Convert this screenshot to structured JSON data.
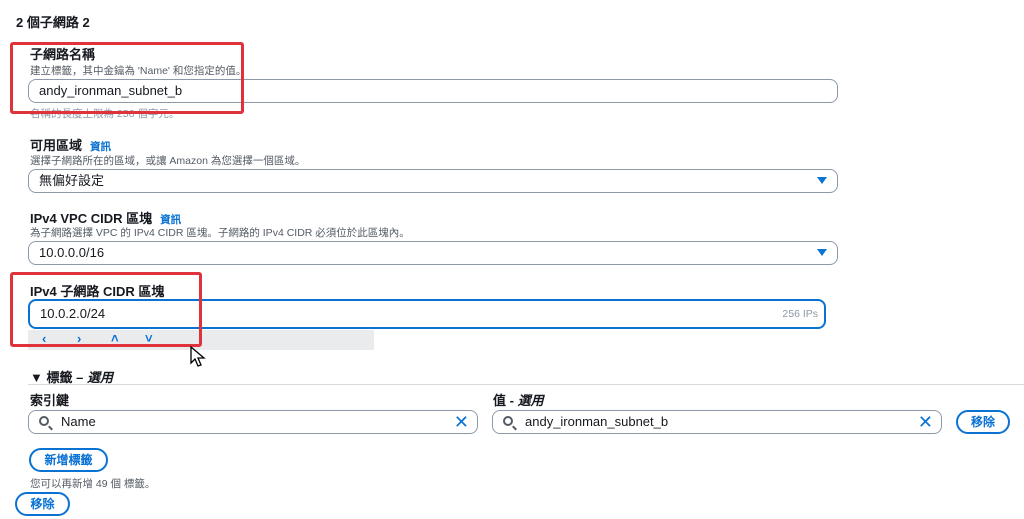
{
  "section_title": "2 個子網路 2",
  "subnet_name": {
    "label": "子網路名稱",
    "desc": "建立標籤，其中金鑰為 'Name' 和您指定的值。",
    "value": "andy_ironman_subnet_b",
    "hint": "名稱的長度上限為 256 個字元。"
  },
  "az": {
    "label": "可用區域",
    "info": "資訊",
    "desc": "選擇子網路所在的區域，或讓 Amazon 為您選擇一個區域。",
    "value": "無偏好設定"
  },
  "vpc_cidr": {
    "label": "IPv4 VPC CIDR 區塊",
    "info": "資訊",
    "desc": "為子網路選擇 VPC 的 IPv4 CIDR 區塊。子網路的 IPv4 CIDR 必須位於此區塊內。",
    "value": "10.0.0.0/16"
  },
  "subnet_cidr": {
    "label": "IPv4 子網路 CIDR 區塊",
    "value": "10.0.2.0/24",
    "ips": "256 IPs",
    "arrows": [
      "‹",
      "›",
      "˄",
      "˅"
    ]
  },
  "tags": {
    "toggle": "▼ 標籤 – ",
    "toggle_optional": "選用",
    "key_label": "索引鍵",
    "value_label_main": "值 - ",
    "value_label_optional": "選用",
    "key_value": "Name",
    "value_value": "andy_ironman_subnet_b",
    "remove_label": "移除",
    "add_label": "新增標籤",
    "remaining": "您可以再新增 49 個 標籤。"
  },
  "remove_subnet_label": "移除",
  "colors": {
    "accent": "#0972d3",
    "highlight": "#e0323b"
  }
}
